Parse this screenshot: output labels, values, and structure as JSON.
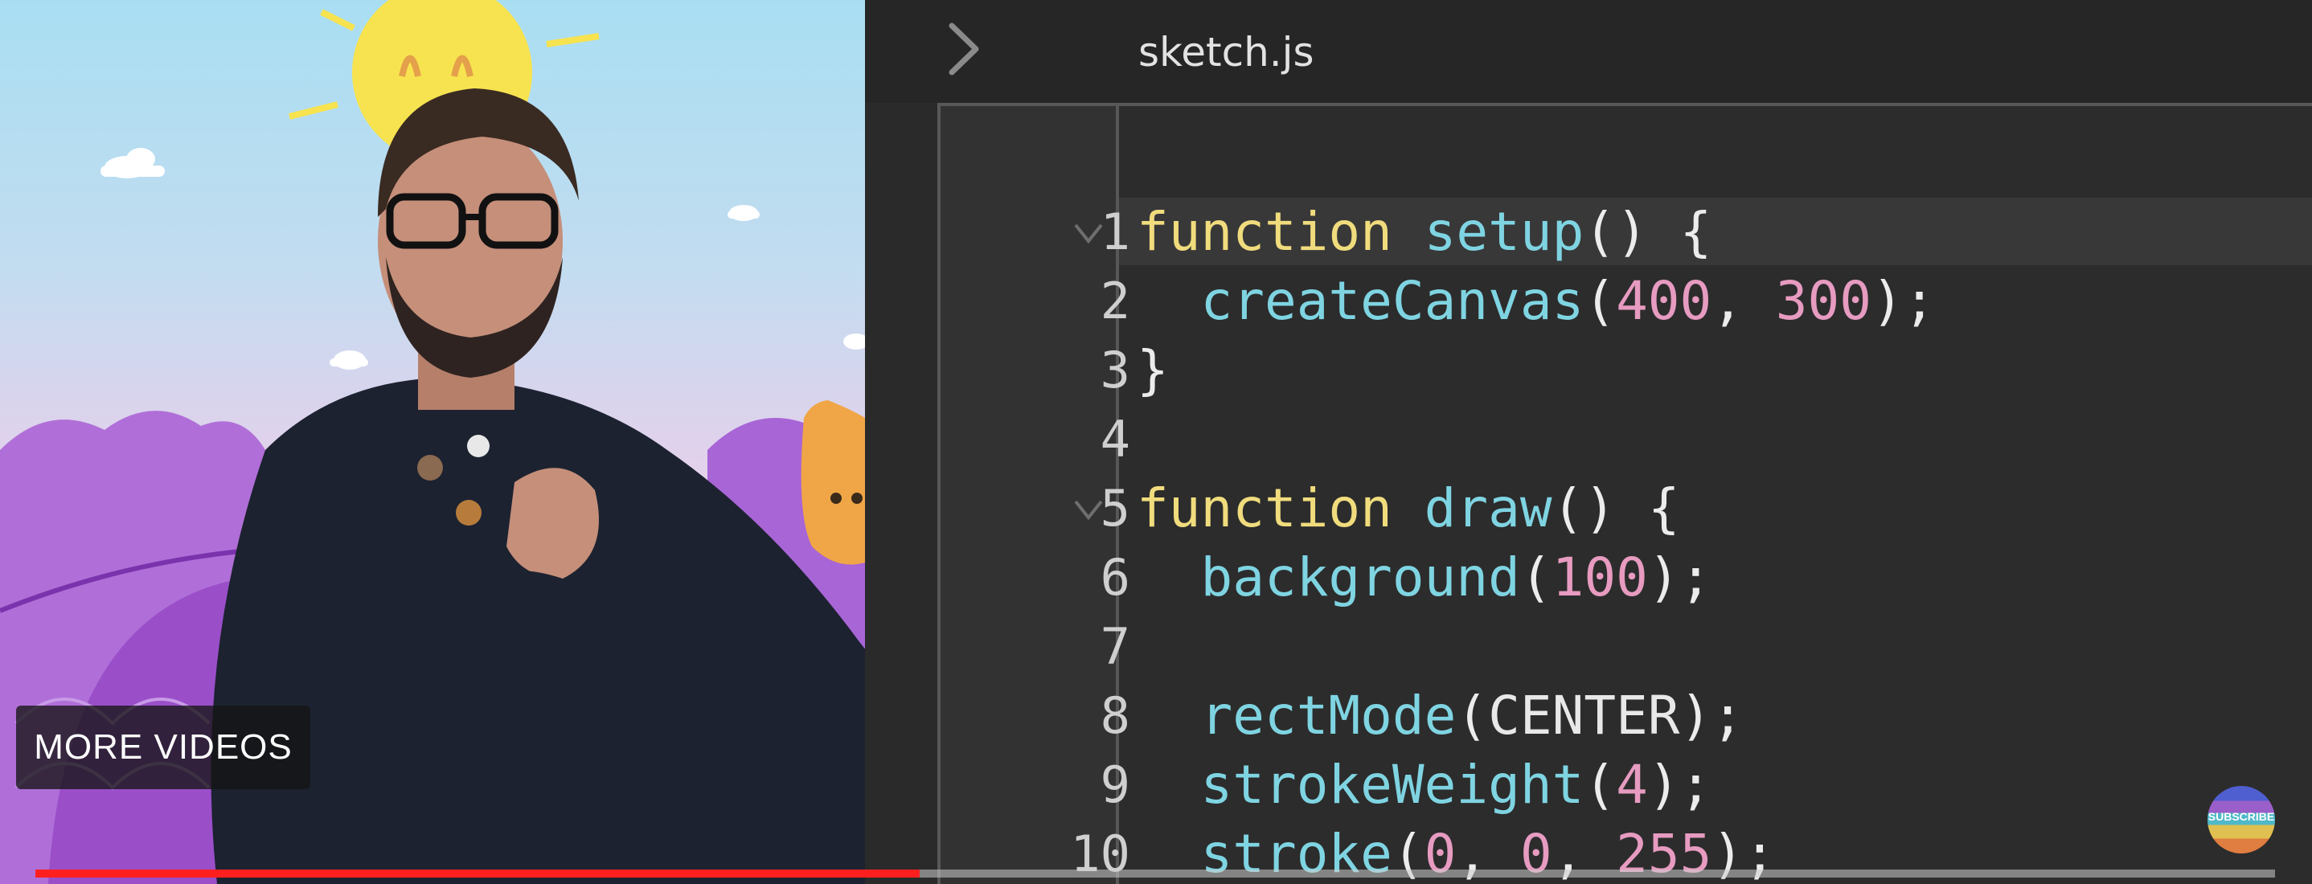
{
  "editor": {
    "filename": "sketch.js",
    "lines": [
      {
        "number": "1",
        "text": "function setup() {"
      },
      {
        "number": "2",
        "text": "  createCanvas(400, 300);"
      },
      {
        "number": "3",
        "text": "}"
      },
      {
        "number": "4",
        "text": ""
      },
      {
        "number": "5",
        "text": "function draw() {"
      },
      {
        "number": "6",
        "text": "  background(100);"
      },
      {
        "number": "7",
        "text": ""
      },
      {
        "number": "8",
        "text": "  rectMode(CENTER);"
      },
      {
        "number": "9",
        "text": "  strokeWeight(4);"
      },
      {
        "number": "10",
        "text": "  stroke(0, 0, 255);"
      }
    ],
    "colors": {
      "keyword": "#f0dc7d",
      "function": "#7fd4e2",
      "number": "#e79bc0",
      "text": "#e8e8e8"
    }
  },
  "overlay": {
    "more_videos_label": "MORE VIDEOS",
    "subscribe_label": "SUBSCRIBE",
    "progress_fraction": 0.395,
    "progress_color": "#ff1f1f"
  },
  "icons": {
    "expand": "chevron-right-icon",
    "fold": "chevron-down-icon"
  }
}
